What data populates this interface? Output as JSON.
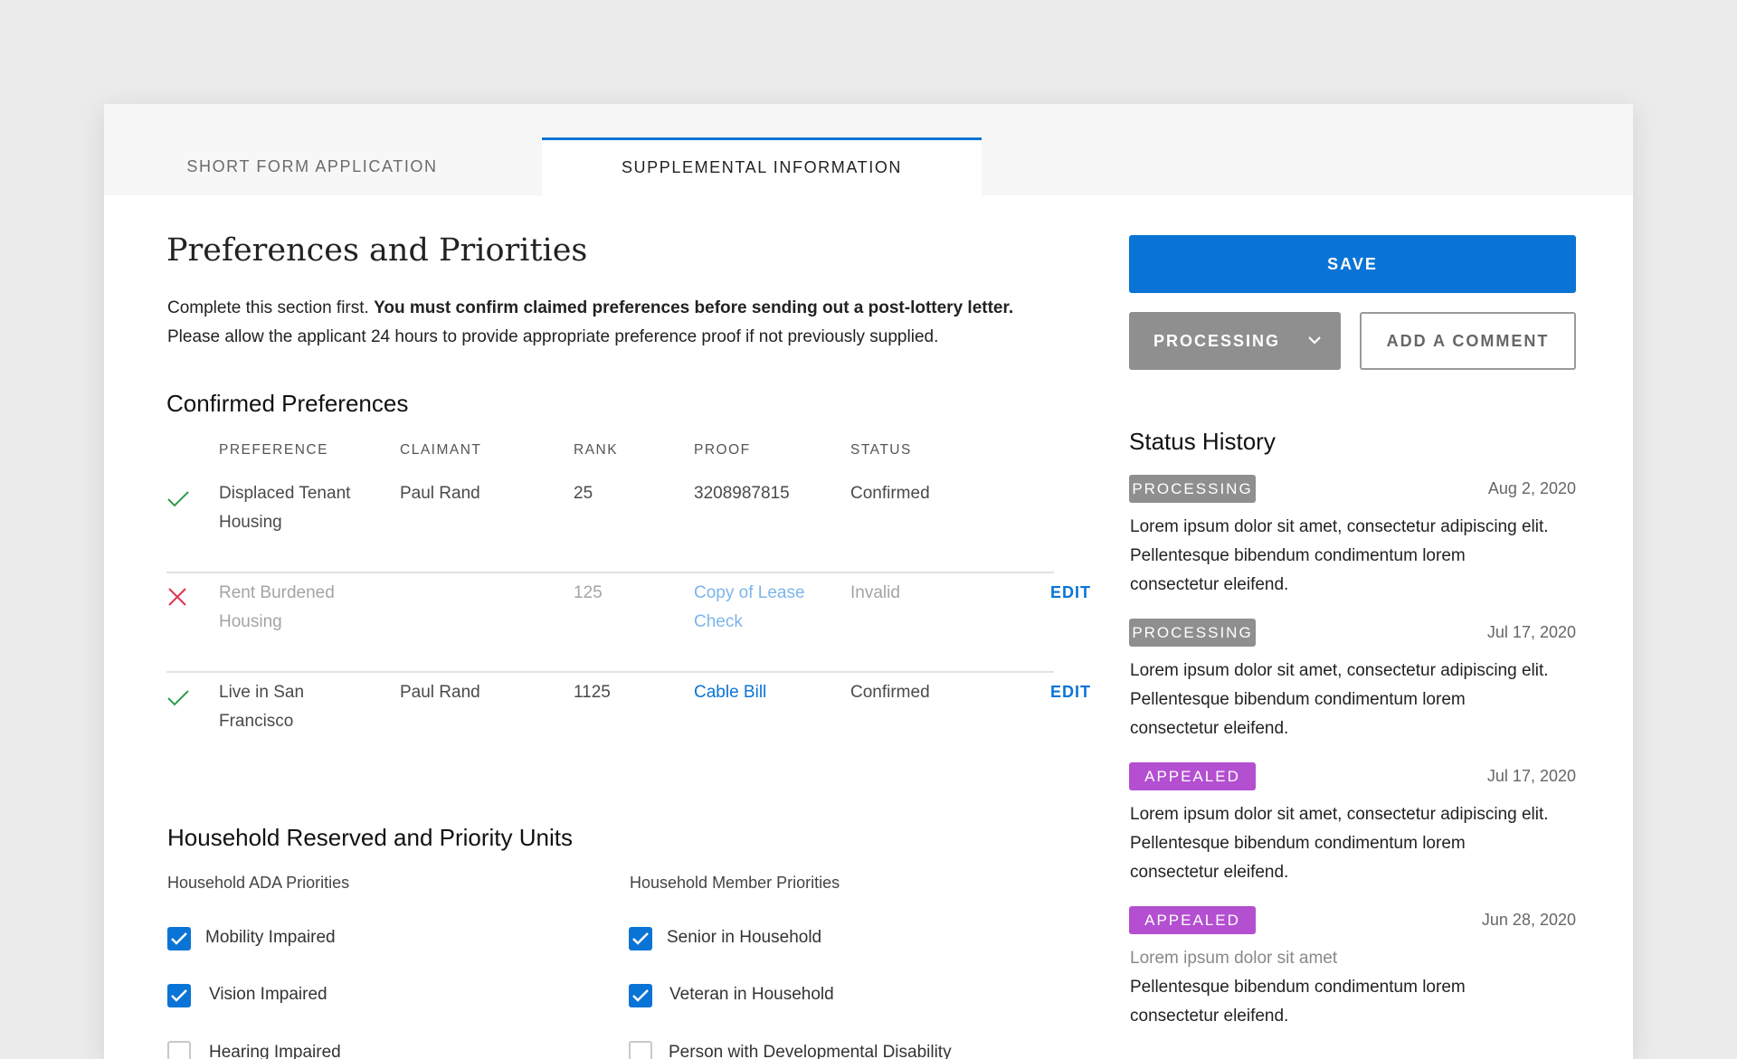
{
  "tabs": [
    {
      "label": "SHORT FORM APPLICATION",
      "active": false
    },
    {
      "label": "SUPPLEMENTAL INFORMATION",
      "active": true
    }
  ],
  "section": {
    "title": "Preferences and Priorities",
    "intro_plain": "Complete this section first. ",
    "intro_bold": "You must confirm claimed preferences before sending out a post-lottery letter.",
    "intro_line2": "Please allow the applicant 24 hours to provide appropriate preference proof if not previously supplied."
  },
  "confirmed_preferences": {
    "heading": "Confirmed Preferences",
    "columns": [
      "PREFERENCE",
      "CLAIMANT",
      "RANK",
      "PROOF",
      "STATUS"
    ],
    "rows": [
      {
        "icon": "check-icon",
        "pref_1": "Displaced Tenant",
        "pref_2": "Housing",
        "claimant": "Paul Rand",
        "rank": "25",
        "proof_1": "3208987815",
        "proof_2": "",
        "status": "Confirmed",
        "action": ""
      },
      {
        "icon": "x-icon",
        "pref_1": "Rent Burdened",
        "pref_2": "Housing",
        "claimant": "",
        "rank": "125",
        "proof_1": "Copy of Lease",
        "proof_2": "Check",
        "status": "Invalid",
        "action": "EDIT"
      },
      {
        "icon": "check-icon",
        "pref_1": "Live in San",
        "pref_2": "Francisco",
        "claimant": "Paul Rand",
        "rank": "1125",
        "proof_1": "Cable Bill",
        "proof_2": "",
        "status": "Confirmed",
        "action": "EDIT"
      }
    ]
  },
  "household": {
    "heading": "Household Reserved and Priority Units",
    "ada": {
      "label": "Household ADA Priorities",
      "items": [
        {
          "label": "Mobility Impaired",
          "checked": true
        },
        {
          "label": "Vision Impaired",
          "checked": true
        },
        {
          "label": "Hearing Impaired",
          "checked": false
        }
      ]
    },
    "member": {
      "label": "Household Member Priorities",
      "items": [
        {
          "label": "Senior in Household",
          "checked": true
        },
        {
          "label": "Veteran in Household",
          "checked": true
        },
        {
          "label": "Person with Developmental Disability",
          "checked": false
        }
      ]
    }
  },
  "actions": {
    "save_label": "SAVE",
    "status_label": "PROCESSING",
    "comment_label": "ADD A COMMENT"
  },
  "status_history": {
    "heading": "Status History",
    "entries": [
      {
        "badge": "PROCESSING",
        "date": "Aug 2, 2020",
        "line1": "Lorem ipsum dolor sit amet, consectetur adipiscing elit.",
        "line2": "Pellentesque bibendum condimentum lorem",
        "line3": "consectetur eleifend."
      },
      {
        "badge": "PROCESSING",
        "date": "Jul 17, 2020",
        "line1": "Lorem ipsum dolor sit amet, consectetur adipiscing elit.",
        "line2": "Pellentesque bibendum condimentum lorem",
        "line3": "consectetur eleifend."
      },
      {
        "badge": "APPEALED",
        "date": "Jul 17, 2020",
        "line1": "Lorem ipsum dolor sit amet, consectetur adipiscing elit.",
        "line2": "Pellentesque bibendum condimentum lorem",
        "line3": "consectetur eleifend."
      },
      {
        "badge": "APPEALED",
        "date": "Jun 28, 2020",
        "line1": "Lorem ipsum dolor sit amet",
        "line2": "Pellentesque bibendum condimentum lorem",
        "line3": "consectetur eleifend."
      }
    ]
  },
  "colors": {
    "accent": "#0a74d6",
    "processing": "#8f8f8f",
    "appealed": "#b34fd0",
    "check_green": "#2e9d4a",
    "invalid_red": "#e0344f"
  }
}
